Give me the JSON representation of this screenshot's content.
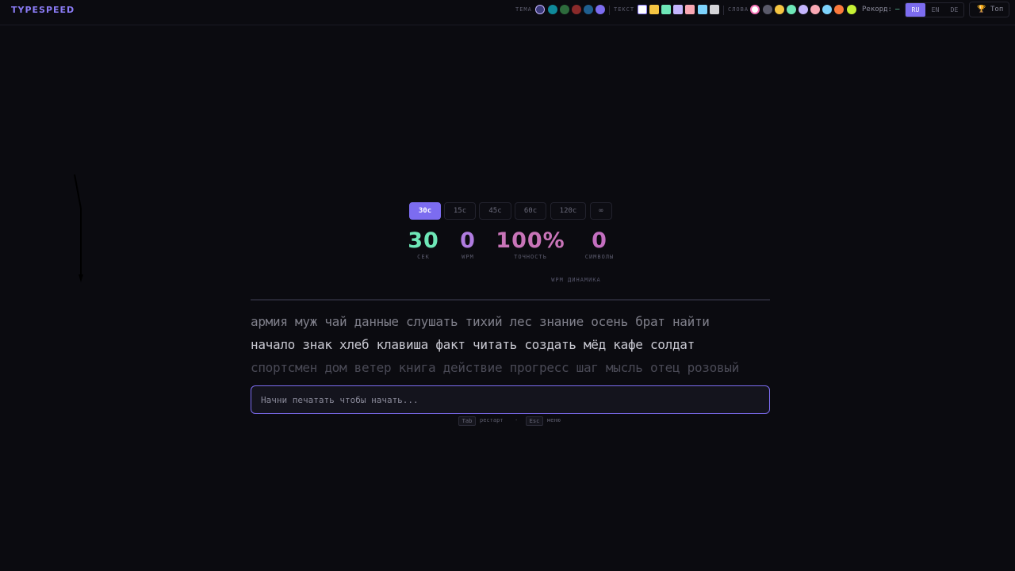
{
  "header": {
    "logo": "TYPESPEED",
    "theme_label": "ТЕМА",
    "text_label": "ТЕКСТ",
    "words_label": "СЛОВА",
    "theme_swatches": [
      "#3b3a7a",
      "#0f8a9a",
      "#2d6b3c",
      "#8a2a2a",
      "#1f5f8f",
      "#7c6cf0"
    ],
    "text_swatches": [
      "#ffffff",
      "#f5c542",
      "#6ee7b7",
      "#c4b5fd",
      "#f9a8b4",
      "#7dd3fc",
      "#d4d4d8"
    ],
    "word_swatches": [
      "#f472b6",
      "#5a5a6a",
      "#f5c542",
      "#6ee7b7",
      "#c4b5fd",
      "#f9a8b4",
      "#7dd3fc",
      "#fb7a3c",
      "#c6f135"
    ],
    "record_label": "Рекорд:",
    "record_value": "—",
    "languages": [
      "RU",
      "EN",
      "DE"
    ],
    "active_language": "RU",
    "top_label": "Топ"
  },
  "durations": [
    "30с",
    "15с",
    "45с",
    "60с",
    "120с",
    "∞"
  ],
  "active_duration": "30с",
  "stats": {
    "seconds": "30",
    "seconds_label": "СЕК",
    "wpm": "0",
    "wpm_label": "WPM",
    "accuracy": "100%",
    "accuracy_label": "ТОЧНОСТЬ",
    "chars": "0",
    "chars_label": "СИМВОЛЫ"
  },
  "graph_title": "WPM ДИНАМИКА",
  "text_lines": [
    "армия муж чай данные слушать тихий лес знание осень брат найти",
    "начало знак хлеб клавиша факт читать создать мёд кафе солдат",
    "спортсмен дом ветер книга действие прогресс шаг мысль отец розовый"
  ],
  "input": {
    "placeholder": "Начни печатать чтобы начать...",
    "value": ""
  },
  "hints": {
    "tab_key": "Tab",
    "tab_action": "рестарт",
    "separator": "·",
    "esc_key": "Esc",
    "esc_action": "меню"
  }
}
